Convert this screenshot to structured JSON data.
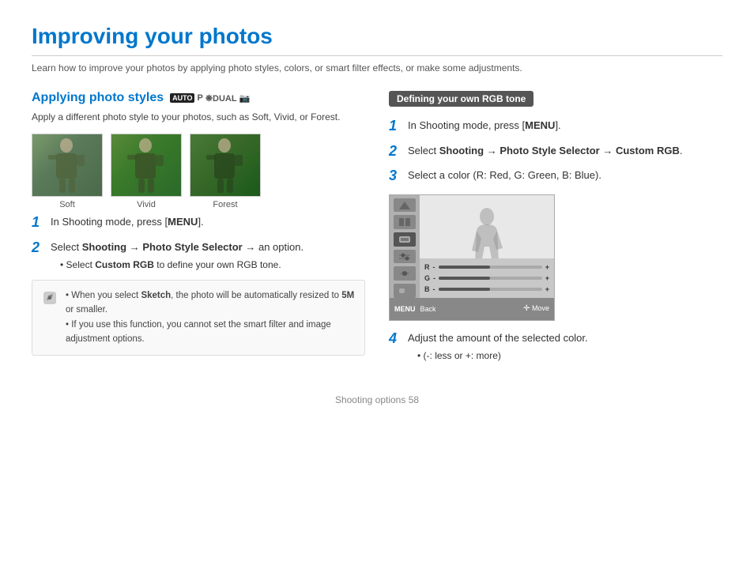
{
  "page": {
    "title": "Improving your photos",
    "subtitle": "Learn how to improve your photos by applying photo styles, colors, or smart filter effects, or make some adjustments.",
    "footer": "Shooting options  58"
  },
  "left": {
    "section_title": "Applying photo styles",
    "modes": [
      "AUTO",
      "P",
      "DUAL",
      "📷"
    ],
    "section_desc": "Apply a different photo style to your photos, such as Soft, Vivid, or Forest.",
    "photos": [
      {
        "label": "Soft",
        "style": "soft"
      },
      {
        "label": "Vivid",
        "style": "vivid"
      },
      {
        "label": "Forest",
        "style": "forest"
      }
    ],
    "steps": [
      {
        "num": "1",
        "text": "In Shooting mode, press [",
        "bold": "MENU",
        "text2": "]."
      },
      {
        "num": "2",
        "text_parts": [
          "Select ",
          "Shooting",
          " → ",
          "Photo Style Selector",
          " → an option."
        ],
        "bold": [
          "Shooting",
          "Photo Style Selector"
        ],
        "sub": [
          "Select Custom RGB to define your own RGB tone."
        ]
      }
    ],
    "note": {
      "bullets": [
        "When you select Sketch, the photo will be automatically resized to 5M or smaller.",
        "If you use this function, you cannot set the smart filter and image adjustment options."
      ],
      "sketch_bold": "Sketch",
      "size_bold": "5M"
    }
  },
  "right": {
    "badge": "Defining your own RGB tone",
    "steps": [
      {
        "num": "1",
        "text": "In Shooting mode, press [",
        "bold": "MENU",
        "text2": "]."
      },
      {
        "num": "2",
        "text_parts": [
          "Select ",
          "Shooting",
          " → ",
          "Photo Style Selector",
          " → ",
          "Custom RGB",
          "."
        ],
        "bold": [
          "Shooting",
          "Photo Style Selector",
          "Custom RGB"
        ]
      },
      {
        "num": "3",
        "text": "Select a color (R: Red, G: Green, B: Blue)."
      },
      {
        "num": "4",
        "text": "Adjust the amount of the selected color.",
        "sub": [
          "(-: less or +: more)"
        ]
      }
    ],
    "screen": {
      "sliders": [
        {
          "label": "R",
          "value": 50
        },
        {
          "label": "G",
          "value": 50
        },
        {
          "label": "B",
          "value": 50
        }
      ],
      "footer_menu": "MENU",
      "footer_back": "Back",
      "footer_cross": "✛",
      "footer_move": "Move"
    }
  }
}
